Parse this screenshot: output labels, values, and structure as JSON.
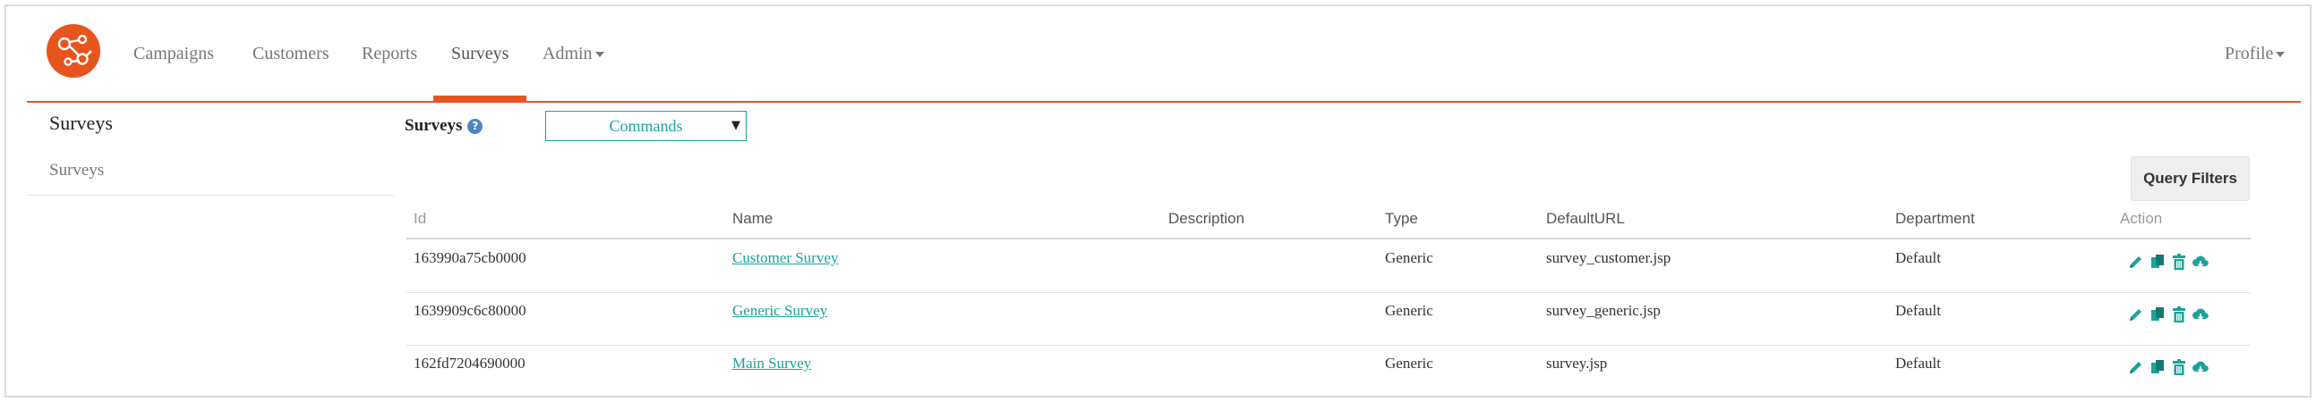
{
  "nav": {
    "items": [
      {
        "label": "Campaigns"
      },
      {
        "label": "Customers"
      },
      {
        "label": "Reports"
      },
      {
        "label": "Surveys",
        "active": true
      },
      {
        "label": "Admin",
        "dropdown": true
      }
    ],
    "profile_label": "Profile",
    "accent_color": "#e8541e"
  },
  "sidebar": {
    "title": "Surveys",
    "items": [
      {
        "label": "Surveys"
      }
    ]
  },
  "main": {
    "title": "Surveys",
    "help_icon": "?",
    "commands_label": "Commands",
    "commands_arrow": "▼",
    "query_filters_label": "Query Filters"
  },
  "table": {
    "columns": [
      "Id",
      "Name",
      "Description",
      "Type",
      "DefaultURL",
      "Department",
      "Action"
    ],
    "rows": [
      {
        "id": "163990a75cb0000",
        "name": "Customer Survey",
        "description": "",
        "type": "Generic",
        "url": "survey_customer.jsp",
        "department": "Default",
        "actions": [
          "edit-icon",
          "copy-icon",
          "delete-icon",
          "download-icon"
        ]
      },
      {
        "id": "1639909c6c80000",
        "name": "Generic Survey",
        "description": "",
        "type": "Generic",
        "url": "survey_generic.jsp",
        "department": "Default",
        "actions": [
          "edit-icon",
          "copy-icon",
          "delete-icon",
          "download-icon"
        ]
      },
      {
        "id": "162fd7204690000",
        "name": "Main Survey",
        "description": "",
        "type": "Generic",
        "url": "survey.jsp",
        "department": "Default",
        "actions": [
          "edit-icon",
          "copy-icon",
          "delete-icon",
          "download-icon"
        ]
      }
    ],
    "link_color": "#1aa39a",
    "icon_color": "#1aa39a"
  }
}
